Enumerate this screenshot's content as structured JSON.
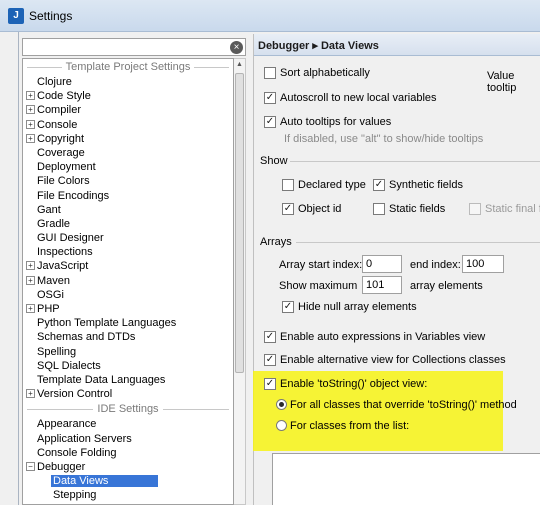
{
  "window": {
    "title": "Settings",
    "icon": "intellij-icon"
  },
  "search": {
    "value": "",
    "placeholder": ""
  },
  "tree": {
    "sections": [
      {
        "header": "Template Project Settings",
        "items": [
          {
            "label": "Clojure",
            "expandable": false
          },
          {
            "label": "Code Style",
            "expandable": true
          },
          {
            "label": "Compiler",
            "expandable": true
          },
          {
            "label": "Console",
            "expandable": true
          },
          {
            "label": "Copyright",
            "expandable": true
          },
          {
            "label": "Coverage",
            "expandable": false
          },
          {
            "label": "Deployment",
            "expandable": false
          },
          {
            "label": "File Colors",
            "expandable": false
          },
          {
            "label": "File Encodings",
            "expandable": false
          },
          {
            "label": "Gant",
            "expandable": false
          },
          {
            "label": "Gradle",
            "expandable": false
          },
          {
            "label": "GUI Designer",
            "expandable": false
          },
          {
            "label": "Inspections",
            "expandable": false
          },
          {
            "label": "JavaScript",
            "expandable": true
          },
          {
            "label": "Maven",
            "expandable": true
          },
          {
            "label": "OSGi",
            "expandable": false
          },
          {
            "label": "PHP",
            "expandable": true
          },
          {
            "label": "Python Template Languages",
            "expandable": false
          },
          {
            "label": "Schemas and DTDs",
            "expandable": false
          },
          {
            "label": "Spelling",
            "expandable": false
          },
          {
            "label": "SQL Dialects",
            "expandable": false
          },
          {
            "label": "Template Data Languages",
            "expandable": false
          },
          {
            "label": "Version Control",
            "expandable": true
          }
        ]
      },
      {
        "header": "IDE Settings",
        "items": [
          {
            "label": "Appearance",
            "expandable": false
          },
          {
            "label": "Application Servers",
            "expandable": false
          },
          {
            "label": "Console Folding",
            "expandable": false
          },
          {
            "label": "Debugger",
            "expandable": true,
            "expanded": true
          },
          {
            "label": "Data Views",
            "child": true,
            "selected": true
          },
          {
            "label": "Stepping",
            "child": true
          }
        ]
      }
    ]
  },
  "breadcrumb": "Debugger ▸ Data Views",
  "options": {
    "sort_alpha": {
      "label": "Sort alphabetically",
      "checked": false
    },
    "value_tooltip": "Value tooltip",
    "autoscroll": {
      "label": "Autoscroll to new local variables",
      "checked": true
    },
    "auto_tooltips": {
      "label": "Auto tooltips for values",
      "checked": true
    },
    "tooltip_hint": "If disabled, use \"alt\" to show/hide tooltips"
  },
  "show": {
    "title": "Show",
    "declared_type": {
      "label": "Declared type",
      "checked": false
    },
    "synthetic_fields": {
      "label": "Synthetic fields",
      "checked": true
    },
    "object_id": {
      "label": "Object id",
      "checked": true
    },
    "static_fields": {
      "label": "Static fields",
      "checked": false
    },
    "static_final": {
      "label": "Static final fie",
      "checked": false,
      "disabled": true
    }
  },
  "arrays": {
    "title": "Arrays",
    "start_label": "Array start index:",
    "start_value": "0",
    "end_label": "end index:",
    "end_value": "100",
    "show_max_label": "Show maximum",
    "show_max_value": "101",
    "elements_label": "array elements",
    "hide_null": {
      "label": "Hide null array elements",
      "checked": true
    }
  },
  "more": {
    "auto_expr": {
      "label": "Enable auto expressions in Variables view",
      "checked": true
    },
    "alt_view": {
      "label": "Enable alternative view for Collections classes",
      "checked": true
    },
    "tostring": {
      "label": "Enable 'toString()' object view:",
      "checked": true
    },
    "radio_all": {
      "label": "For all classes that override 'toString()' method",
      "selected": true
    },
    "radio_list": {
      "label": "For classes from the list:",
      "selected": false
    }
  },
  "colors": {
    "highlight": "#f7f314",
    "selection": "#3875d7",
    "crumb": "#d6e0ee"
  }
}
